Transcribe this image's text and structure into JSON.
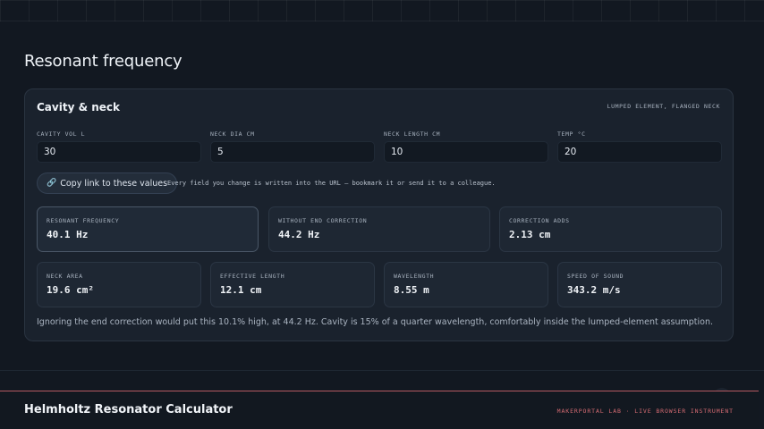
{
  "page": {
    "title": "Resonant frequency"
  },
  "panel": {
    "title": "Cavity & neck",
    "tag": "LUMPED ELEMENT, FLANGED NECK"
  },
  "inputs": [
    {
      "label": "CAVITY VOL L",
      "value": "30"
    },
    {
      "label": "NECK DIA CM",
      "value": "5"
    },
    {
      "label": "NECK LENGTH CM",
      "value": "10"
    },
    {
      "label": "TEMP °C",
      "value": "20"
    }
  ],
  "copy_button": {
    "label": "Copy link to these values",
    "icon": "link-icon"
  },
  "hint": "Every field you change is written into the URL — bookmark it or send it to a colleague.",
  "results_top": [
    {
      "label": "RESONANT FREQUENCY",
      "value": "40.1 Hz"
    },
    {
      "label": "WITHOUT END CORRECTION",
      "value": "44.2 Hz"
    },
    {
      "label": "CORRECTION ADDS",
      "value": "2.13 cm"
    }
  ],
  "results_bottom": [
    {
      "label": "NECK AREA",
      "value": "19.6 cm²"
    },
    {
      "label": "EFFECTIVE LENGTH",
      "value": "12.1 cm"
    },
    {
      "label": "WAVELENGTH",
      "value": "8.55 m"
    },
    {
      "label": "SPEED OF SOUND",
      "value": "343.2 m/s"
    }
  ],
  "summary": "Ignoring the end correction would put this 10.1% high, at 44.2 Hz. Cavity is 15% of a quarter wavelength, comfortably inside the lumped-element assumption.",
  "footer": {
    "title": "Helmholtz Resonator Calculator",
    "tag": "MAKERPORTAL LAB · LIVE BROWSER INSTRUMENT"
  },
  "colors": {
    "background": "#121821",
    "panel": "#1a222d",
    "accent": "#d56b72"
  }
}
